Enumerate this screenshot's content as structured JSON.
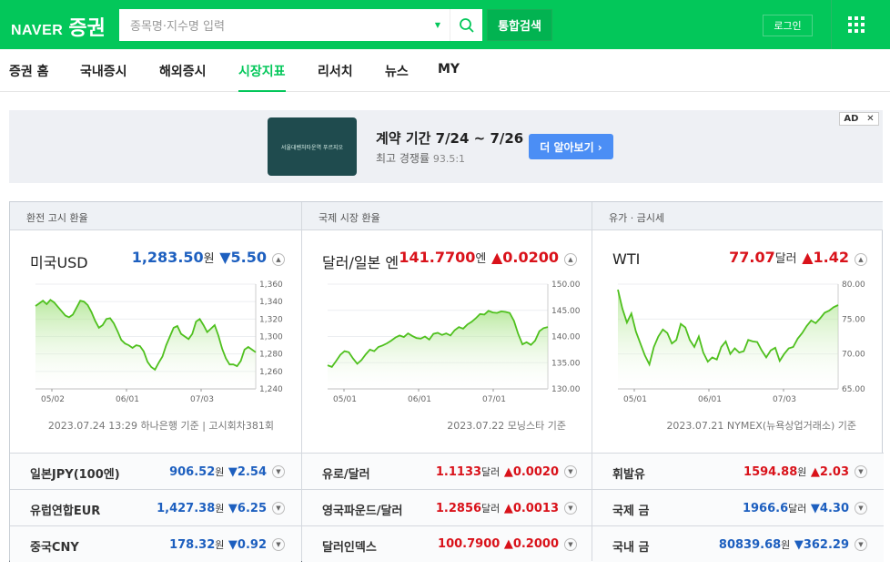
{
  "header": {
    "logo_brand": "NAVER",
    "logo_service": "증권",
    "search_placeholder": "종목명·지수명 입력",
    "search_button": "통합검색",
    "login": "로그인"
  },
  "nav": [
    "증권 홈",
    "국내증시",
    "해외증시",
    "시장지표",
    "리서치",
    "뉴스",
    "MY"
  ],
  "nav_active": "시장지표",
  "ad": {
    "thumb_text": "서울대벤처타운역 푸르지오",
    "title": "계약 기간 7/24 ~ 7/26",
    "subtitle": "최고 경쟁률",
    "subtitle_value": "93.5:1",
    "cta": "더 알아보기 ›",
    "badge": "AD",
    "close": "✕"
  },
  "columns": [
    {
      "header": "환전 고시 환율",
      "name": "미국USD",
      "price": "1,283.50",
      "unit": "원",
      "change": "5.50",
      "direction": "down",
      "source": "2023.07.24 13:29 하나은행 기준 | 고시회차381회",
      "chart": {
        "yticks": [
          "1,360",
          "1,340",
          "1,320",
          "1,300",
          "1,280",
          "1,260",
          "1,240"
        ],
        "ymin": 1240,
        "ymax": 1360,
        "xticks": [
          "05/02",
          "06/01",
          "07/03"
        ],
        "values": [
          1335,
          1338,
          1341,
          1337,
          1342,
          1339,
          1334,
          1329,
          1324,
          1322,
          1325,
          1333,
          1341,
          1340,
          1336,
          1328,
          1318,
          1310,
          1313,
          1320,
          1321,
          1315,
          1306,
          1296,
          1292,
          1290,
          1287,
          1290,
          1289,
          1283,
          1271,
          1265,
          1262,
          1270,
          1277,
          1290,
          1300,
          1310,
          1312,
          1303,
          1300,
          1297,
          1303,
          1317,
          1320,
          1313,
          1305,
          1309,
          1313,
          1301,
          1286,
          1275,
          1268,
          1268,
          1266,
          1272,
          1285,
          1288,
          1285,
          1282
        ]
      },
      "rows": [
        {
          "name": "일본JPY(100엔)",
          "price": "906.52",
          "unit": "원",
          "change": "2.54",
          "direction": "down"
        },
        {
          "name": "유럽연합EUR",
          "price": "1,427.38",
          "unit": "원",
          "change": "6.25",
          "direction": "down"
        },
        {
          "name": "중국CNY",
          "price": "178.32",
          "unit": "원",
          "change": "0.92",
          "direction": "down"
        }
      ]
    },
    {
      "header": "국제 시장 환율",
      "name": "달러/일본 엔",
      "price": "141.7700",
      "unit": "엔",
      "change": "0.0200",
      "direction": "up",
      "source": "2023.07.22 모닝스타 기준",
      "chart": {
        "yticks": [
          "150.00",
          "145.00",
          "140.00",
          "135.00",
          "130.00"
        ],
        "ymin": 130,
        "ymax": 150,
        "xticks": [
          "05/01",
          "06/01",
          "07/01"
        ],
        "values": [
          134.5,
          134.2,
          135.3,
          136.5,
          137.2,
          137.0,
          135.8,
          134.8,
          135.5,
          136.6,
          137.5,
          137.2,
          138.0,
          138.3,
          138.7,
          139.2,
          139.8,
          140.2,
          139.9,
          140.6,
          140.1,
          139.7,
          139.6,
          140.0,
          139.4,
          140.5,
          140.7,
          140.3,
          140.6,
          140.2,
          141.2,
          141.8,
          141.5,
          142.3,
          142.8,
          143.5,
          144.3,
          144.2,
          144.9,
          144.6,
          144.5,
          144.8,
          144.7,
          144.5,
          143.0,
          140.5,
          138.5,
          138.9,
          138.4,
          139.2,
          141.0,
          141.6,
          141.8
        ]
      },
      "rows": [
        {
          "name": "유로/달러",
          "price": "1.1133",
          "unit": "달러",
          "change": "0.0020",
          "direction": "up"
        },
        {
          "name": "영국파운드/달러",
          "price": "1.2856",
          "unit": "달러",
          "change": "0.0013",
          "direction": "up"
        },
        {
          "name": "달러인덱스",
          "price": "100.7900",
          "unit": "",
          "change": "0.2000",
          "direction": "up"
        }
      ]
    },
    {
      "header": "유가 · 금시세",
      "name": "WTI",
      "price": "77.07",
      "unit": "달러",
      "change": "1.42",
      "direction": "up",
      "source": "2023.07.21 NYMEX(뉴욕상업거래소) 기준",
      "chart": {
        "yticks": [
          "80.00",
          "75.00",
          "70.00",
          "65.00"
        ],
        "ymin": 65,
        "ymax": 80,
        "xticks": [
          "05/01",
          "06/01",
          "07/03"
        ],
        "values": [
          79.2,
          76.5,
          74.5,
          75.8,
          73.2,
          71.5,
          69.8,
          68.5,
          71.0,
          72.5,
          73.5,
          73.0,
          71.5,
          72.0,
          74.3,
          73.8,
          72.0,
          71.0,
          72.5,
          70.2,
          68.9,
          69.5,
          69.2,
          71.0,
          71.8,
          70.0,
          70.8,
          70.2,
          70.4,
          72.0,
          71.8,
          71.7,
          70.5,
          69.5,
          70.5,
          70.9,
          69.0,
          70.0,
          70.8,
          71.0,
          72.2,
          73.0,
          74.0,
          74.8,
          74.4,
          75.1,
          75.9,
          76.2,
          76.7,
          77.0
        ]
      },
      "rows": [
        {
          "name": "휘발유",
          "price": "1594.88",
          "unit": "원",
          "change": "2.03",
          "direction": "up"
        },
        {
          "name": "국제 금",
          "price": "1966.6",
          "unit": "달러",
          "change": "4.30",
          "direction": "down"
        },
        {
          "name": "국내 금",
          "price": "80839.68",
          "unit": "원",
          "change": "362.29",
          "direction": "down"
        }
      ]
    }
  ]
}
